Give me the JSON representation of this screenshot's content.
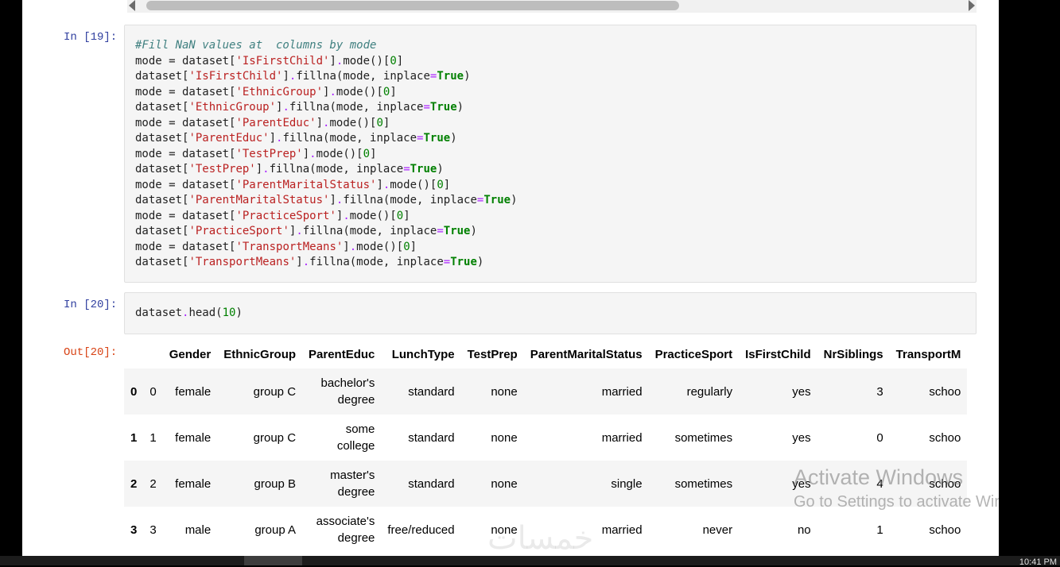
{
  "cells": [
    {
      "prompt": "In [19]:",
      "lines": [
        [
          {
            "t": "#Fill NaN values at  columns by mode",
            "c": "comment"
          }
        ],
        [
          {
            "t": "mode = dataset["
          },
          {
            "t": "'IsFirstChild'",
            "c": "str"
          },
          {
            "t": "]"
          },
          {
            "t": ".",
            "c": "op"
          },
          {
            "t": "mode()["
          },
          {
            "t": "0",
            "c": "num"
          },
          {
            "t": "]"
          }
        ],
        [
          {
            "t": "dataset["
          },
          {
            "t": "'IsFirstChild'",
            "c": "str"
          },
          {
            "t": "]"
          },
          {
            "t": ".",
            "c": "op"
          },
          {
            "t": "fillna(mode, inplace"
          },
          {
            "t": "=",
            "c": "op"
          },
          {
            "t": "True",
            "c": "kw"
          },
          {
            "t": ")"
          }
        ],
        [
          {
            "t": "mode = dataset["
          },
          {
            "t": "'EthnicGroup'",
            "c": "str"
          },
          {
            "t": "]"
          },
          {
            "t": ".",
            "c": "op"
          },
          {
            "t": "mode()["
          },
          {
            "t": "0",
            "c": "num"
          },
          {
            "t": "]"
          }
        ],
        [
          {
            "t": "dataset["
          },
          {
            "t": "'EthnicGroup'",
            "c": "str"
          },
          {
            "t": "]"
          },
          {
            "t": ".",
            "c": "op"
          },
          {
            "t": "fillna(mode, inplace"
          },
          {
            "t": "=",
            "c": "op"
          },
          {
            "t": "True",
            "c": "kw"
          },
          {
            "t": ")"
          }
        ],
        [
          {
            "t": "mode = dataset["
          },
          {
            "t": "'ParentEduc'",
            "c": "str"
          },
          {
            "t": "]"
          },
          {
            "t": ".",
            "c": "op"
          },
          {
            "t": "mode()["
          },
          {
            "t": "0",
            "c": "num"
          },
          {
            "t": "]"
          }
        ],
        [
          {
            "t": "dataset["
          },
          {
            "t": "'ParentEduc'",
            "c": "str"
          },
          {
            "t": "]"
          },
          {
            "t": ".",
            "c": "op"
          },
          {
            "t": "fillna(mode, inplace"
          },
          {
            "t": "=",
            "c": "op"
          },
          {
            "t": "True",
            "c": "kw"
          },
          {
            "t": ")"
          }
        ],
        [
          {
            "t": "mode = dataset["
          },
          {
            "t": "'TestPrep'",
            "c": "str"
          },
          {
            "t": "]"
          },
          {
            "t": ".",
            "c": "op"
          },
          {
            "t": "mode()["
          },
          {
            "t": "0",
            "c": "num"
          },
          {
            "t": "]"
          }
        ],
        [
          {
            "t": "dataset["
          },
          {
            "t": "'TestPrep'",
            "c": "str"
          },
          {
            "t": "]"
          },
          {
            "t": ".",
            "c": "op"
          },
          {
            "t": "fillna(mode, inplace"
          },
          {
            "t": "=",
            "c": "op"
          },
          {
            "t": "True",
            "c": "kw"
          },
          {
            "t": ")"
          }
        ],
        [
          {
            "t": "mode = dataset["
          },
          {
            "t": "'ParentMaritalStatus'",
            "c": "str"
          },
          {
            "t": "]"
          },
          {
            "t": ".",
            "c": "op"
          },
          {
            "t": "mode()["
          },
          {
            "t": "0",
            "c": "num"
          },
          {
            "t": "]"
          }
        ],
        [
          {
            "t": "dataset["
          },
          {
            "t": "'ParentMaritalStatus'",
            "c": "str"
          },
          {
            "t": "]"
          },
          {
            "t": ".",
            "c": "op"
          },
          {
            "t": "fillna(mode, inplace"
          },
          {
            "t": "=",
            "c": "op"
          },
          {
            "t": "True",
            "c": "kw"
          },
          {
            "t": ")"
          }
        ],
        [
          {
            "t": "mode = dataset["
          },
          {
            "t": "'PracticeSport'",
            "c": "str"
          },
          {
            "t": "]"
          },
          {
            "t": ".",
            "c": "op"
          },
          {
            "t": "mode()["
          },
          {
            "t": "0",
            "c": "num"
          },
          {
            "t": "]"
          }
        ],
        [
          {
            "t": "dataset["
          },
          {
            "t": "'PracticeSport'",
            "c": "str"
          },
          {
            "t": "]"
          },
          {
            "t": ".",
            "c": "op"
          },
          {
            "t": "fillna(mode, inplace"
          },
          {
            "t": "=",
            "c": "op"
          },
          {
            "t": "True",
            "c": "kw"
          },
          {
            "t": ")"
          }
        ],
        [
          {
            "t": "mode = dataset["
          },
          {
            "t": "'TransportMeans'",
            "c": "str"
          },
          {
            "t": "]"
          },
          {
            "t": ".",
            "c": "op"
          },
          {
            "t": "mode()["
          },
          {
            "t": "0",
            "c": "num"
          },
          {
            "t": "]"
          }
        ],
        [
          {
            "t": "dataset["
          },
          {
            "t": "'TransportMeans'",
            "c": "str"
          },
          {
            "t": "]"
          },
          {
            "t": ".",
            "c": "op"
          },
          {
            "t": "fillna(mode, inplace"
          },
          {
            "t": "=",
            "c": "op"
          },
          {
            "t": "True",
            "c": "kw"
          },
          {
            "t": ")"
          }
        ]
      ]
    },
    {
      "prompt": "In [20]:",
      "lines": [
        [
          {
            "t": "dataset"
          },
          {
            "t": ".",
            "c": "op"
          },
          {
            "t": "head("
          },
          {
            "t": "10",
            "c": "num"
          },
          {
            "t": ")"
          }
        ]
      ]
    }
  ],
  "output": {
    "prompt": "Out[20]:",
    "columns": [
      "",
      "",
      "Gender",
      "EthnicGroup",
      "ParentEduc",
      "LunchType",
      "TestPrep",
      "ParentMaritalStatus",
      "PracticeSport",
      "IsFirstChild",
      "NrSiblings",
      "TransportM"
    ],
    "rows": [
      {
        "index": "0",
        "cells": [
          "0",
          "female",
          "group C",
          [
            "bachelor's",
            "degree"
          ],
          "standard",
          "none",
          "married",
          "regularly",
          "yes",
          "3",
          "schoo"
        ]
      },
      {
        "index": "1",
        "cells": [
          "1",
          "female",
          "group C",
          [
            "some",
            "college"
          ],
          "standard",
          "none",
          "married",
          "sometimes",
          "yes",
          "0",
          "schoo"
        ]
      },
      {
        "index": "2",
        "cells": [
          "2",
          "female",
          "group B",
          [
            "master's",
            "degree"
          ],
          "standard",
          "none",
          "single",
          "sometimes",
          "yes",
          "4",
          "schoo"
        ]
      },
      {
        "index": "3",
        "cells": [
          "3",
          "male",
          "group A",
          [
            "associate's",
            "degree"
          ],
          "free/reduced",
          "none",
          "married",
          "never",
          "no",
          "1",
          "schoo"
        ]
      }
    ]
  },
  "watermark": {
    "line1": "Activate Windows",
    "line2": "Go to Settings to activate Windows."
  },
  "logo_text": "خمسات",
  "taskbar": {
    "clock": "10:41 PM"
  },
  "colors": {
    "prompt_in": "#303f9f",
    "prompt_out": "#d84315",
    "string": "#ba2121",
    "keyword": "#008000",
    "comment": "#408080",
    "operator": "#aa22ff"
  }
}
